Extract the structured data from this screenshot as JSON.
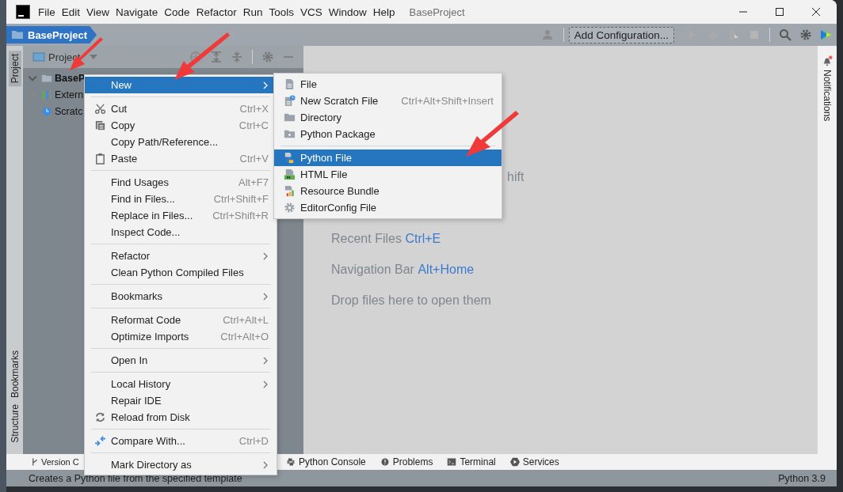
{
  "window": {
    "title": "BaseProject",
    "menu": [
      "File",
      "Edit",
      "View",
      "Navigate",
      "Code",
      "Refactor",
      "Run",
      "Tools",
      "VCS",
      "Window",
      "Help"
    ]
  },
  "navbar": {
    "breadcrumb": "BaseProject",
    "run_config": "Add Configuration..."
  },
  "left_stripe": [
    {
      "label": "Project",
      "selected": true,
      "kind": "top"
    },
    {
      "label": "Bookmarks",
      "selected": false,
      "kind": "bottom"
    },
    {
      "label": "Structure",
      "selected": false,
      "kind": "bottom"
    }
  ],
  "project_panel": {
    "title": "Project",
    "tree": [
      {
        "label": "BaseP",
        "kind": "folder",
        "expanded": true
      },
      {
        "label": "Extern",
        "kind": "library",
        "expanded": false
      },
      {
        "label": "Scratc",
        "kind": "scratch"
      }
    ]
  },
  "editor": {
    "hints": [
      {
        "label": "hift",
        "kind": "partial"
      },
      {
        "label": "Recent Files",
        "shortcut": "Ctrl+E",
        "kind": "hint"
      },
      {
        "label": "Navigation Bar",
        "shortcut": "Alt+Home",
        "kind": "hint"
      },
      {
        "label": "Drop files here to open them",
        "kind": "hint"
      }
    ]
  },
  "right_stripe": {
    "label": "Notifications",
    "unread": true
  },
  "context_menu": {
    "groups": [
      [
        {
          "label": "New",
          "selected": true,
          "submenu": true,
          "kind": "plain"
        }
      ],
      [
        {
          "label": "Cut",
          "shortcut": "Ctrl+X",
          "selected": false,
          "submenu": false,
          "kind": "scissors"
        },
        {
          "label": "Copy",
          "shortcut": "Ctrl+C",
          "selected": false,
          "submenu": false,
          "kind": "copy"
        },
        {
          "label": "Copy Path/Reference...",
          "selected": false,
          "submenu": false,
          "kind": "plain"
        },
        {
          "label": "Paste",
          "shortcut": "Ctrl+V",
          "selected": false,
          "submenu": false,
          "kind": "clipboard"
        }
      ],
      [
        {
          "label": "Find Usages",
          "shortcut": "Alt+F7",
          "selected": false,
          "submenu": false,
          "kind": "plain"
        },
        {
          "label": "Find in Files...",
          "shortcut": "Ctrl+Shift+F",
          "selected": false,
          "submenu": false,
          "kind": "plain"
        },
        {
          "label": "Replace in Files...",
          "shortcut": "Ctrl+Shift+R",
          "selected": false,
          "submenu": false,
          "kind": "plain"
        },
        {
          "label": "Inspect Code...",
          "selected": false,
          "submenu": false,
          "kind": "plain"
        }
      ],
      [
        {
          "label": "Refactor",
          "selected": false,
          "submenu": true,
          "kind": "plain"
        },
        {
          "label": "Clean Python Compiled Files",
          "selected": false,
          "submenu": false,
          "kind": "plain"
        }
      ],
      [
        {
          "label": "Bookmarks",
          "selected": false,
          "submenu": true,
          "kind": "plain"
        }
      ],
      [
        {
          "label": "Reformat Code",
          "shortcut": "Ctrl+Alt+L",
          "selected": false,
          "submenu": false,
          "kind": "plain"
        },
        {
          "label": "Optimize Imports",
          "shortcut": "Ctrl+Alt+O",
          "selected": false,
          "submenu": false,
          "kind": "plain"
        }
      ],
      [
        {
          "label": "Open In",
          "selected": false,
          "submenu": true,
          "kind": "plain"
        }
      ],
      [
        {
          "label": "Local History",
          "selected": false,
          "submenu": true,
          "kind": "plain"
        },
        {
          "label": "Repair IDE",
          "selected": false,
          "submenu": false,
          "kind": "plain"
        },
        {
          "label": "Reload from Disk",
          "selected": false,
          "submenu": false,
          "kind": "reload"
        }
      ],
      [
        {
          "label": "Compare With...",
          "shortcut": "Ctrl+D",
          "selected": false,
          "submenu": false,
          "kind": "compare"
        }
      ],
      [
        {
          "label": "Mark Directory as",
          "selected": false,
          "submenu": true,
          "kind": "plain"
        }
      ]
    ]
  },
  "submenu": {
    "groups": [
      [
        {
          "label": "File",
          "selected": false,
          "kind": "file"
        },
        {
          "label": "New Scratch File",
          "shortcut": "Ctrl+Alt+Shift+Insert",
          "selected": false,
          "kind": "scratch"
        },
        {
          "label": "Directory",
          "selected": false,
          "kind": "folder"
        },
        {
          "label": "Python Package",
          "selected": false,
          "kind": "package"
        }
      ],
      [
        {
          "label": "Python File",
          "selected": true,
          "kind": "python"
        },
        {
          "label": "HTML File",
          "selected": false,
          "kind": "html"
        },
        {
          "label": "Resource Bundle",
          "selected": false,
          "kind": "bundle"
        },
        {
          "label": "EditorConfig File",
          "selected": false,
          "kind": "gear"
        }
      ]
    ]
  },
  "tool_windows": [
    {
      "label": "Version C",
      "kind": "vcs"
    },
    {
      "label": "Python Console",
      "kind": "python"
    },
    {
      "label": "Problems",
      "kind": "problems"
    },
    {
      "label": "Terminal",
      "kind": "terminal"
    },
    {
      "label": "Services",
      "kind": "services"
    }
  ],
  "status_bar": {
    "message": "Creates a Python file from the specified template",
    "interpreter": "Python 3.9"
  }
}
